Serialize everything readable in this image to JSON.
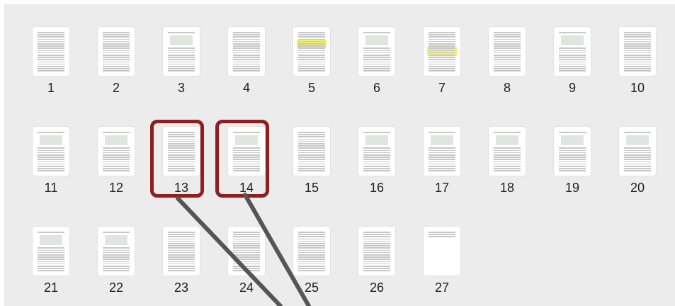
{
  "pages": [
    {
      "number": "1"
    },
    {
      "number": "2"
    },
    {
      "number": "3"
    },
    {
      "number": "4"
    },
    {
      "number": "5"
    },
    {
      "number": "6"
    },
    {
      "number": "7"
    },
    {
      "number": "8"
    },
    {
      "number": "9"
    },
    {
      "number": "10"
    },
    {
      "number": "11"
    },
    {
      "number": "12"
    },
    {
      "number": "13"
    },
    {
      "number": "14"
    },
    {
      "number": "15"
    },
    {
      "number": "16"
    },
    {
      "number": "17"
    },
    {
      "number": "18"
    },
    {
      "number": "19"
    },
    {
      "number": "20"
    },
    {
      "number": "21"
    },
    {
      "number": "22"
    },
    {
      "number": "23"
    },
    {
      "number": "24"
    },
    {
      "number": "25"
    },
    {
      "number": "26"
    },
    {
      "number": "27"
    }
  ],
  "selected_pages": [
    "13",
    "14"
  ],
  "colors": {
    "selection": "#8f1f1f",
    "annotation_line": "#555555",
    "highlight": "#f3f06a"
  }
}
